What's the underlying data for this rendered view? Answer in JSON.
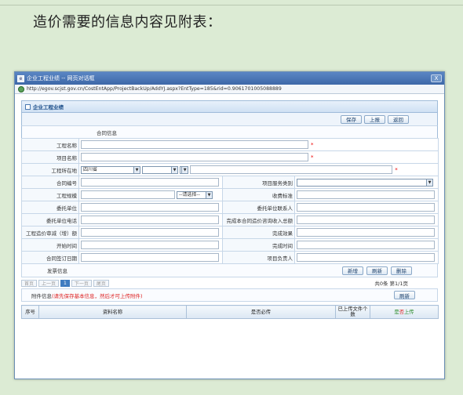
{
  "doc": {
    "heading": "造价需要的信息内容见附表："
  },
  "window": {
    "title": "企业工程业绩 -- 网页对话框",
    "url": "http://egov.scjst.gov.cn/CostEntApp/ProjectBackUp/AddYJ.aspx?EntType=185&rid=0.9061701005088889",
    "close": "X"
  },
  "panel": {
    "title": "企业工程业绩"
  },
  "toolbar": {
    "save": "保存",
    "report": "上报",
    "back": "返回"
  },
  "contract_section": "合同信息",
  "fields": {
    "project_name": "工程名称",
    "item_name": "项目名称",
    "location": "工程所在地",
    "province": "四川省",
    "contract_no": "合同编号",
    "service_type": "项目服务类别",
    "scale": "工程规模",
    "scale_select": "--请选择--",
    "fee_standard": "收费标准",
    "client": "委托单位",
    "client_contact": "委托单位联系人",
    "client_phone": "委托单位电话",
    "income": "完成本合同造价咨询收入总额",
    "amount": "工程造价审减（增）额",
    "result": "完成效果",
    "start": "开始时间",
    "finish": "完成时间",
    "sign_date": "合同签订日期",
    "manager": "项目负责人",
    "required_mark": "*"
  },
  "invoice": {
    "label": "发票信息",
    "add": "新增",
    "refresh": "刷新",
    "delete": "删除"
  },
  "pager": {
    "first": "首页",
    "prev": "上一页",
    "current": "1",
    "next": "下一页",
    "last": "尾页",
    "total": "共0条 第1/1页"
  },
  "attach": {
    "label": "附件信息",
    "note": "(请先保存基本信息，然后才可上传附件)",
    "refresh": "刷新"
  },
  "grid": {
    "cols": [
      "序号",
      "资料名称",
      "是否必传",
      "已上传文件个数"
    ],
    "upload_yes": "是",
    "upload_no": "否",
    "upload_suffix": "上传"
  }
}
